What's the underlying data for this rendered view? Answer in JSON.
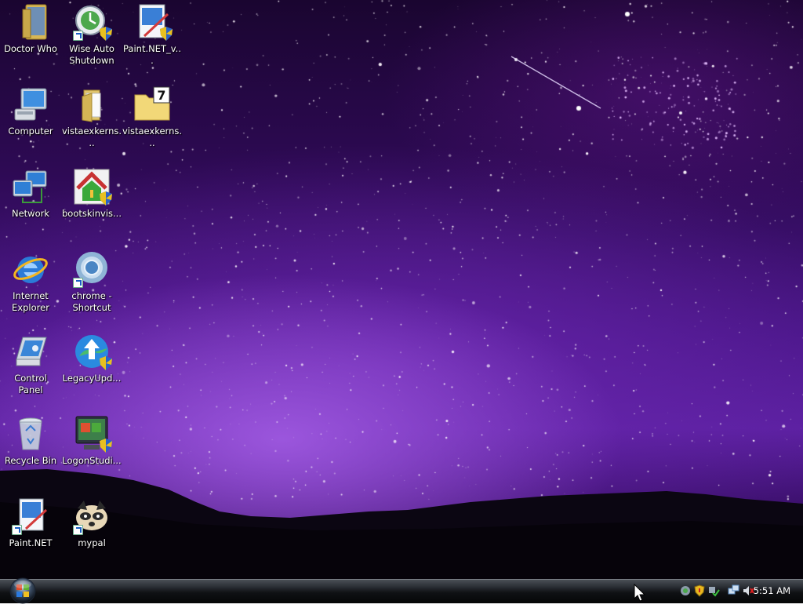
{
  "desktop": {
    "icons": [
      {
        "label": "Doctor Who",
        "icon": "folder-icon"
      },
      {
        "label": "Wise Auto Shutdown",
        "icon": "wise-auto-shutdown-icon"
      },
      {
        "label": "Paint.NET_v...",
        "icon": "paint-net-installer-icon"
      },
      {
        "label": "Computer",
        "icon": "computer-icon"
      },
      {
        "label": "vistaexkerns...",
        "icon": "folder-icon"
      },
      {
        "label": "vistaexkerns...",
        "icon": "7zip-archive-icon"
      },
      {
        "label": "Network",
        "icon": "network-icon"
      },
      {
        "label": "bootskinvis...",
        "icon": "bootskin-icon"
      },
      {
        "label": "Internet Explorer",
        "icon": "internet-explorer-icon"
      },
      {
        "label": "chrome - Shortcut",
        "icon": "chrome-icon"
      },
      {
        "label": "Control Panel",
        "icon": "control-panel-icon"
      },
      {
        "label": "LegacyUpd...",
        "icon": "legacy-update-icon"
      },
      {
        "label": "Recycle Bin",
        "icon": "recycle-bin-icon"
      },
      {
        "label": "LogonStudi...",
        "icon": "logon-studio-icon"
      },
      {
        "label": "Paint.NET",
        "icon": "paint-net-icon"
      },
      {
        "label": "mypal",
        "icon": "mypal-browser-icon"
      }
    ]
  },
  "taskbar": {
    "start_button": "start-orb-icon",
    "tray_icons": [
      "tray-app-icon",
      "security-shield-icon",
      "network-status-icon",
      "network-connections-icon",
      "volume-muted-icon"
    ],
    "clock": "5:51 AM"
  },
  "colors": {
    "sky_top": "#1a0530",
    "sky_glow": "#5b20a0",
    "taskbar": "#0f1114"
  }
}
